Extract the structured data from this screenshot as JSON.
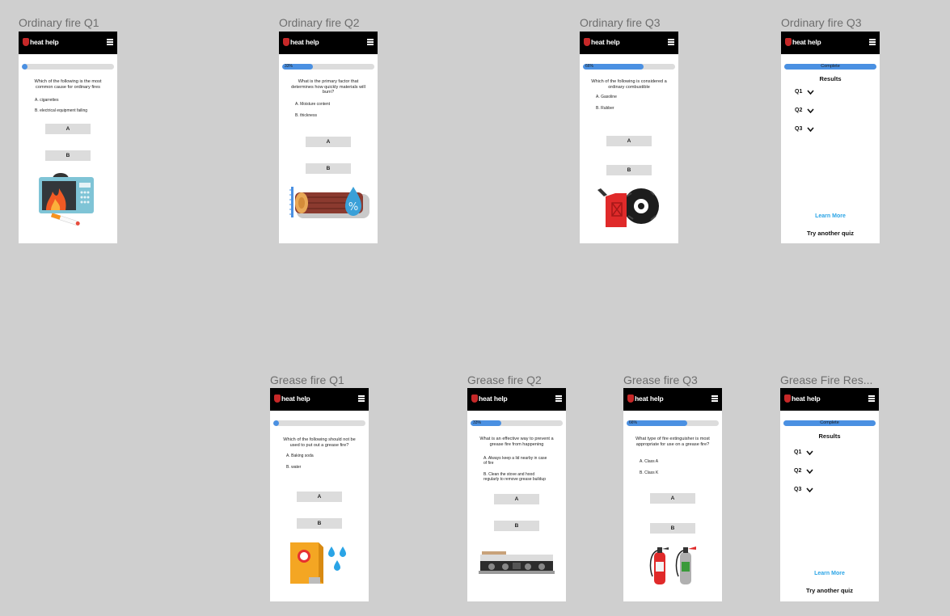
{
  "brand": {
    "name": "heat help",
    "accent": "#4a90e2",
    "header_bg": "#000000",
    "canvas_bg": "#cfcfcf"
  },
  "frames": {
    "of1": {
      "title": "Ordinary fire Q1",
      "progress": 0,
      "question": "Which of the following is the most common cause for ordinary fires",
      "option_a": "A. cigarrettes",
      "option_b": "B. electrical equipment failing",
      "btn_a": "A",
      "btn_b": "B",
      "illustration": "burning-microwave-and-cigarette"
    },
    "of2": {
      "title": "Ordinary fire Q2",
      "progress": 33,
      "progress_label": "33%",
      "question": "What is the primary factor that determines how quickly materials will burn?",
      "option_a": "A. Moisture content",
      "option_b": "B. thickness",
      "btn_a": "A",
      "btn_b": "B",
      "illustration": "log-ruler-and-water-drop"
    },
    "of3": {
      "title": "Ordinary fire Q3",
      "progress": 66,
      "progress_label": "66%",
      "question": "Which of the following is considered a ordinary combustible",
      "option_a": "A. Gasoline",
      "option_b": "B. Rubber",
      "btn_a": "A",
      "btn_b": "B",
      "illustration": "gas-can-and-tire"
    },
    "ofr": {
      "title": "Ordinary fire Q3",
      "progress": 100,
      "progress_label": "Complete",
      "results_title": "Results",
      "q1": "Q1",
      "q2": "Q2",
      "q3": "Q3",
      "learn_more": "Learn More",
      "try_another": "Try another quiz"
    },
    "gf1": {
      "title": "Grease fire Q1",
      "progress": 0,
      "question": "Which of the following should not be used to put out a grease fire?",
      "option_a": "A. Baking soda",
      "option_b": "B. water",
      "btn_a": "A",
      "btn_b": "B",
      "illustration": "baking-soda-box-and-water-drops"
    },
    "gf2": {
      "title": "Grease fire Q2",
      "progress": 33,
      "progress_label": "33%",
      "question": "What is an effective way to prevent a grease fire from happening",
      "option_a": "A. Always keep a lid nearby in case of fire",
      "option_b": "B. Clean the stove and hood regularly to remove grease buildup",
      "btn_a": "A",
      "btn_b": "B",
      "illustration": "stovetop-with-pan"
    },
    "gf3": {
      "title": "Grease fire Q3",
      "progress": 66,
      "progress_label": "66%",
      "question": "What type of fire extinguisher is most appropriate for use on a grease fire?",
      "option_a": "A. Class A",
      "option_b": "B. Class K",
      "btn_a": "A",
      "btn_b": "B",
      "illustration": "two-fire-extinguishers"
    },
    "gfr": {
      "title": "Grease Fire Res...",
      "progress": 100,
      "progress_label": "Complete",
      "results_title": "Results",
      "q1": "Q1",
      "q2": "Q2",
      "q3": "Q3",
      "learn_more": "Learn More",
      "try_another": "Try another quiz"
    }
  }
}
